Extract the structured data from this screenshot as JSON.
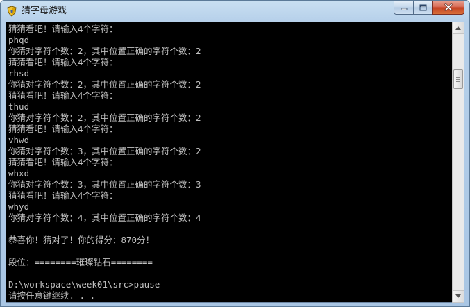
{
  "window": {
    "title": "猜字母游戏",
    "icon": "shield-icon",
    "controls": {
      "minimize": "minimize-icon",
      "maximize": "maximize-icon",
      "close": "close-icon"
    }
  },
  "console": {
    "lines": [
      "猜猜看吧！请输入4个字符：",
      "phqd",
      "你猜对字符个数：2，其中位置正确的字符个数：2",
      "猜猜看吧！请输入4个字符：",
      "rhsd",
      "你猜对字符个数：2，其中位置正确的字符个数：2",
      "猜猜看吧！请输入4个字符：",
      "thud",
      "你猜对字符个数：2，其中位置正确的字符个数：2",
      "猜猜看吧！请输入4个字符：",
      "vhwd",
      "你猜对字符个数：3，其中位置正确的字符个数：2",
      "猜猜看吧！请输入4个字符：",
      "whxd",
      "你猜对字符个数：3，其中位置正确的字符个数：3",
      "猜猜看吧！请输入4个字符：",
      "whyd",
      "你猜对字符个数：4，其中位置正确的字符个数：4",
      "",
      "恭喜你！猜对了！你的得分：870分！",
      "",
      "段位：========璀璨钻石========",
      "",
      "D:\\workspace\\week01\\src>pause",
      "请按任意键继续. . ."
    ]
  },
  "scrollbar": {
    "up_icon": "arrow-up-icon",
    "down_icon": "arrow-down-icon"
  },
  "colors": {
    "console_bg": "#000000",
    "console_text": "#c0c0c0",
    "close_button": "#c7432a"
  }
}
